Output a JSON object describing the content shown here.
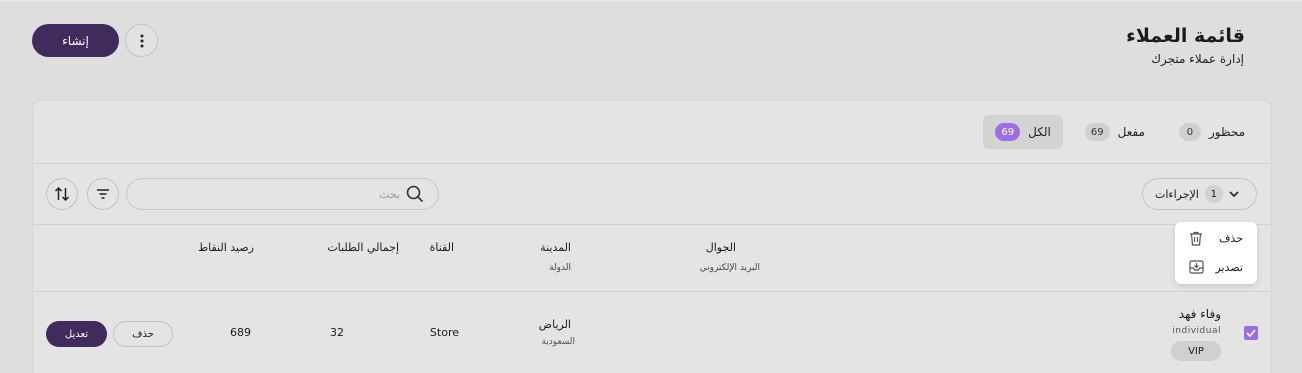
{
  "header": {
    "title": "قائمة العملاء",
    "subtitle": "إدارة عملاء متجرك",
    "create_label": "إنشاء"
  },
  "tabs": [
    {
      "label": "الكل",
      "count": "69",
      "active": true
    },
    {
      "label": "مفعل",
      "count": "69",
      "active": false
    },
    {
      "label": "محظور",
      "count": "0",
      "active": false
    }
  ],
  "toolbar": {
    "actions_label": "الإجراءات",
    "actions_count": "1",
    "search_placeholder": "بحث"
  },
  "menu": {
    "delete_label": "حذف",
    "export_label": "تصدير"
  },
  "table": {
    "headers": {
      "phone": "الجوال",
      "email": "البريد الإلكتروني",
      "city": "المدينة",
      "country": "الدولة",
      "channel": "القناة",
      "orders_total": "إجمالي الطلبات",
      "points": "رصيد النقاط"
    },
    "rows": [
      {
        "name": "وفاء فهد",
        "type": "individual",
        "tag": "VIP",
        "city": "الرياض",
        "country": "السعودية",
        "channel": "Store",
        "orders_total": "32",
        "points": "689",
        "delete_label": "حذف",
        "edit_label": "تعديل"
      }
    ]
  },
  "colors": {
    "primary": "#412a5c",
    "accent": "#9b6ee3",
    "background": "#dedede"
  }
}
